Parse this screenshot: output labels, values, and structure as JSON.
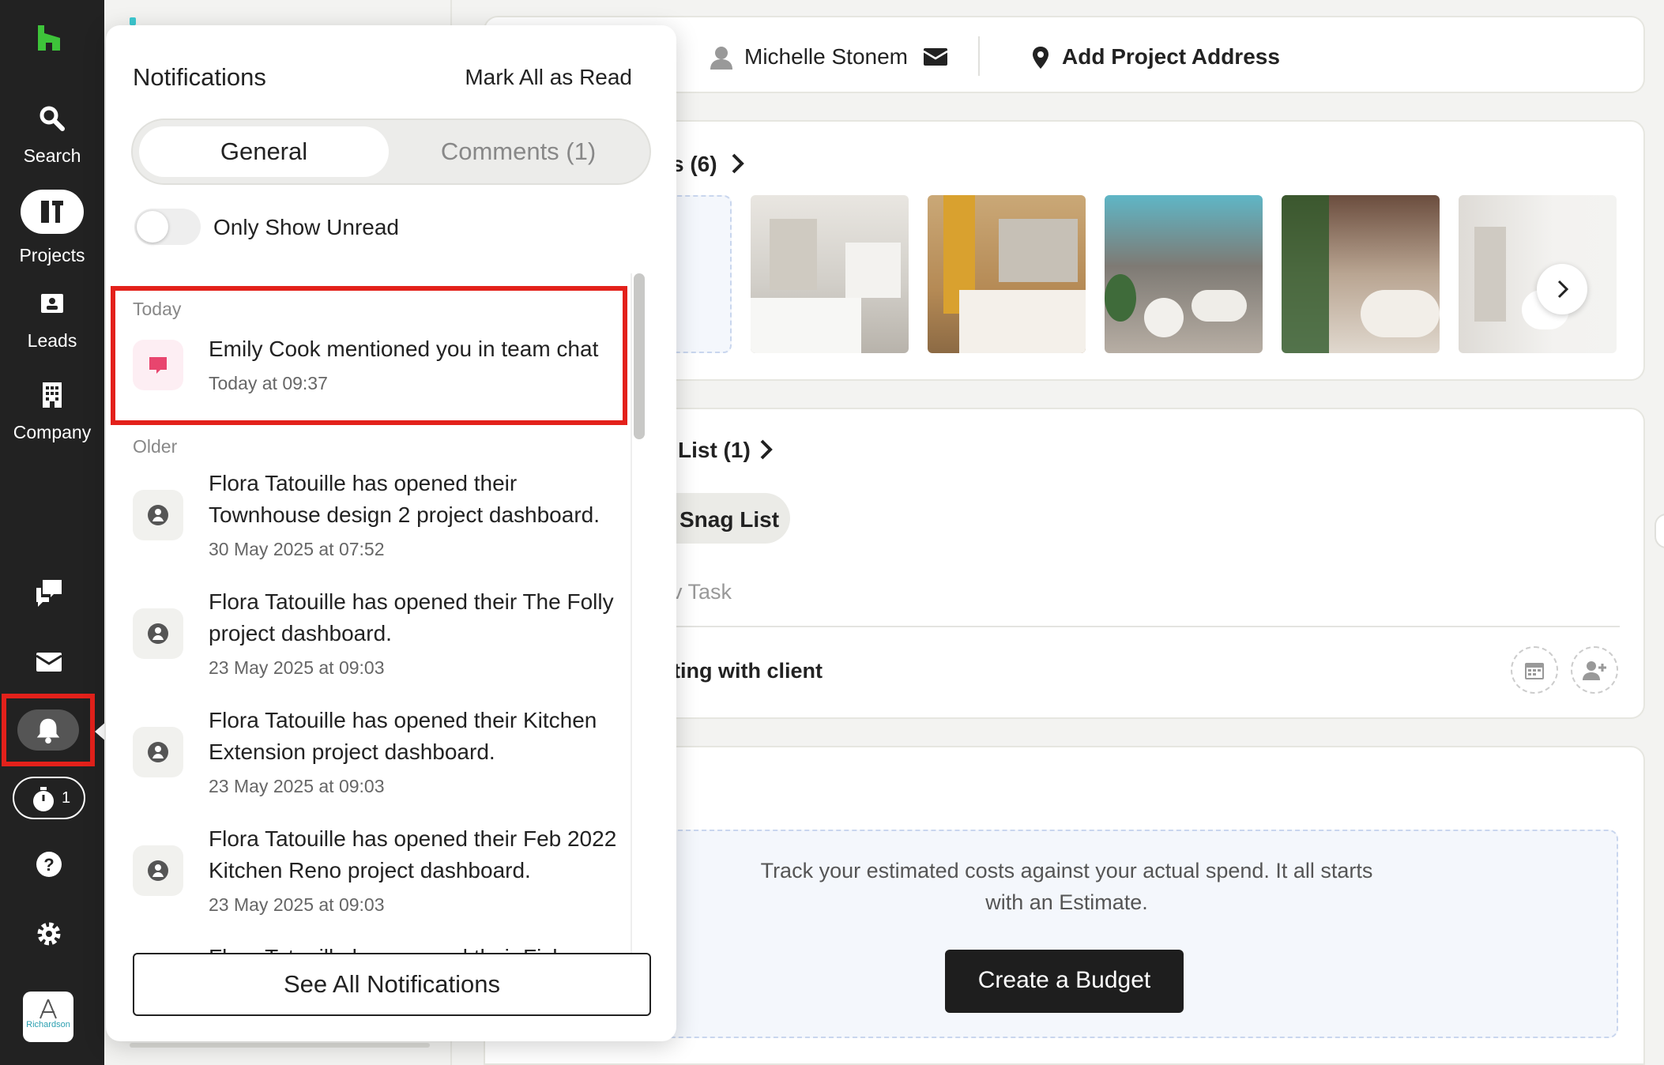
{
  "sidebar": {
    "items": [
      {
        "label": "Search",
        "icon": "search-icon"
      },
      {
        "label": "Projects",
        "icon": "projects-icon"
      },
      {
        "label": "Leads",
        "icon": "leads-icon"
      },
      {
        "label": "Company",
        "icon": "company-icon"
      }
    ],
    "timer_count": "1",
    "logo_text": "Richardson"
  },
  "header": {
    "client_name": "Michelle Stonem",
    "address_label": "Add Project Address"
  },
  "photos": {
    "title_fragment": "s (6)"
  },
  "tasks": {
    "title_fragment": "List (1)",
    "chip_label": "Snag List",
    "new_task_fragment": "v Task",
    "task_fragment": "ting with client"
  },
  "budget": {
    "description": "Track your estimated costs against your actual spend. It all starts with an Estimate.",
    "button_label": "Create a Budget"
  },
  "notifications": {
    "title": "Notifications",
    "mark_all": "Mark All as Read",
    "tabs": {
      "general": "General",
      "comments": "Comments (1)"
    },
    "toggle_label": "Only Show Unread",
    "today_label": "Today",
    "older_label": "Older",
    "today_items": [
      {
        "text": "Emily Cook mentioned you in team chat",
        "time": "Today at 09:37"
      }
    ],
    "older_items": [
      {
        "text": "Flora Tatouille has opened their Townhouse design 2 project dashboard.",
        "time": "30 May 2025 at 07:52"
      },
      {
        "text": "Flora Tatouille has opened their The Folly project dashboard.",
        "time": "23 May 2025 at 09:03"
      },
      {
        "text": "Flora Tatouille has opened their Kitchen Extension project dashboard.",
        "time": "23 May 2025 at 09:03"
      },
      {
        "text": "Flora Tatouille has opened their Feb 2022 Kitchen Reno project dashboard.",
        "time": "23 May 2025 at 09:03"
      },
      {
        "text": "Flora Tatouille has opened their Fish",
        "time": ""
      }
    ],
    "see_all": "See All Notifications"
  },
  "colors": {
    "brand": "#3ec43a",
    "highlight": "#e3211b",
    "sidebar": "#222222"
  }
}
